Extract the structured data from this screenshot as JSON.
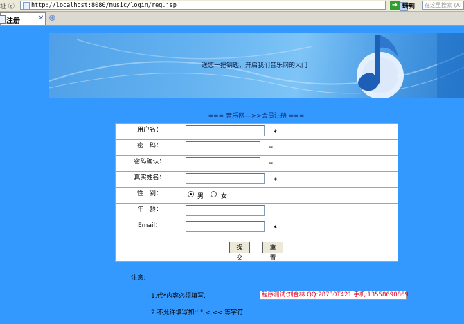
{
  "browser": {
    "address_label": "址 ⓓ",
    "url": "http://localhost:8080/music/login/reg.jsp",
    "go_label": "转到",
    "search_placeholder": "在这里搜索 (Al",
    "tab_title": "注册",
    "tab_close": "✕"
  },
  "banner": {
    "tagline": "送您一把钥匙，开启我们音乐网的大门"
  },
  "section_title": "=== 音乐网--->>会员注册 ===",
  "form": {
    "fields": [
      {
        "label": "用户名：",
        "value": "",
        "required": "*"
      },
      {
        "label": "密　码：",
        "value": "",
        "required": "*"
      },
      {
        "label": "密码确认：",
        "value": "",
        "required": "*"
      },
      {
        "label": "真实姓名：",
        "value": "",
        "required": "*"
      },
      {
        "label": "性　别：",
        "options": [
          "男",
          "女"
        ],
        "selected": "男"
      },
      {
        "label": "年　龄：",
        "value": ""
      },
      {
        "label": "Email：",
        "value": "",
        "required": "*"
      }
    ],
    "submit_label": "提交",
    "reset_label": "重置"
  },
  "notes": {
    "heading": "注意：",
    "lines": [
      "1.代*内容必须填写.",
      "2.不允许填写如:',\",<,<< 等字符."
    ],
    "tester": "程序测试:刘金林 QQ:28730T421 手机:13558690869"
  },
  "colors": {
    "page_bg": "#3399ff",
    "tester_text": "#e0001a"
  }
}
